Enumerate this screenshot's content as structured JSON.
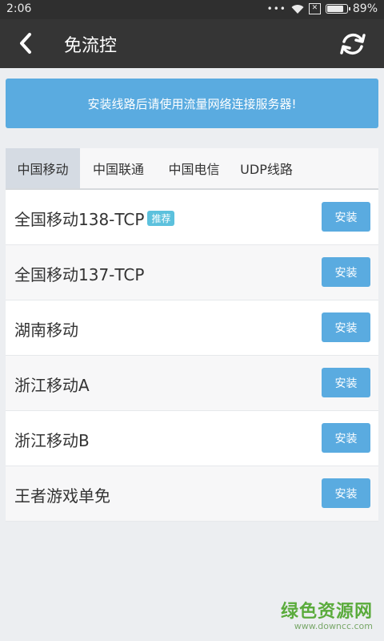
{
  "status_bar": {
    "time": "2:06",
    "dots": "•••",
    "sim": "✕",
    "battery": "89%",
    "battery_level": 0.89
  },
  "app_bar": {
    "title": "免流控"
  },
  "banner": {
    "text": "安装线路后请使用流量网络连接服务器!"
  },
  "tabs": [
    {
      "label": "中国移动",
      "active": true
    },
    {
      "label": "中国联通",
      "active": false
    },
    {
      "label": "中国电信",
      "active": false
    },
    {
      "label": "UDP线路",
      "active": false
    }
  ],
  "routes": [
    {
      "name": "全国移动138-TCP",
      "badge": "推荐",
      "button": "安装"
    },
    {
      "name": "全国移动137-TCP",
      "button": "安装"
    },
    {
      "name": "湖南移动",
      "button": "安装"
    },
    {
      "name": "浙江移动A",
      "button": "安装"
    },
    {
      "name": "浙江移动B",
      "button": "安装"
    },
    {
      "name": "王者游戏单免",
      "button": "安装"
    }
  ],
  "watermark": {
    "logo": "绿色资源网",
    "url": "www.downcc.com"
  }
}
